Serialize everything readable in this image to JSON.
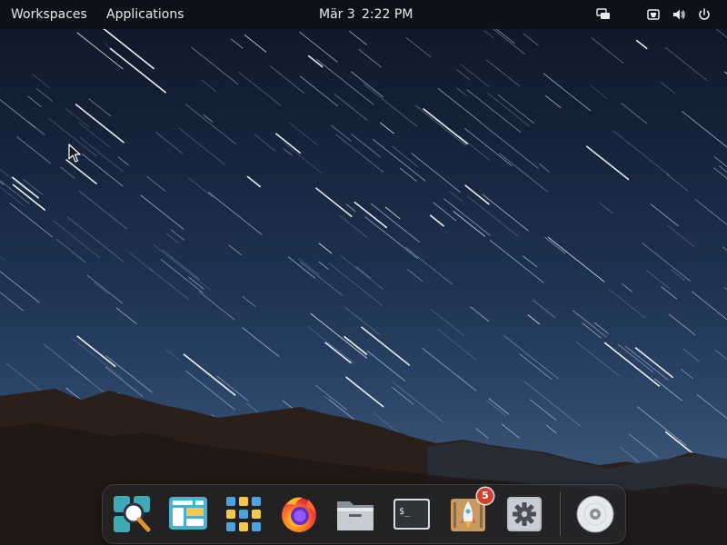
{
  "topbar": {
    "workspaces_label": "Workspaces",
    "applications_label": "Applications",
    "date": "Mär 3",
    "time": "2:22 PM"
  },
  "tray_icons": [
    "display-icon",
    "network-icon",
    "volume-icon",
    "power-icon"
  ],
  "dock": {
    "apps": [
      {
        "id": "search",
        "icon": "magnifier-icon"
      },
      {
        "id": "multitasking",
        "icon": "window-overview-icon"
      },
      {
        "id": "app-grid",
        "icon": "app-grid-icon"
      },
      {
        "id": "firefox",
        "icon": "firefox-icon"
      },
      {
        "id": "files",
        "icon": "folder-icon"
      },
      {
        "id": "terminal",
        "icon": "terminal-icon",
        "prompt": "$_"
      },
      {
        "id": "appcenter",
        "icon": "rocket-icon",
        "badge": "5"
      },
      {
        "id": "settings",
        "icon": "gear-icon"
      },
      {
        "id": "optical-drive",
        "icon": "cd-icon"
      }
    ]
  },
  "colors": {
    "panel": "#0e1016",
    "badge": "#d4412f",
    "sky_top": "#0e1624",
    "sky_bottom": "#3a5478",
    "mountains": "#2a1f1a"
  }
}
